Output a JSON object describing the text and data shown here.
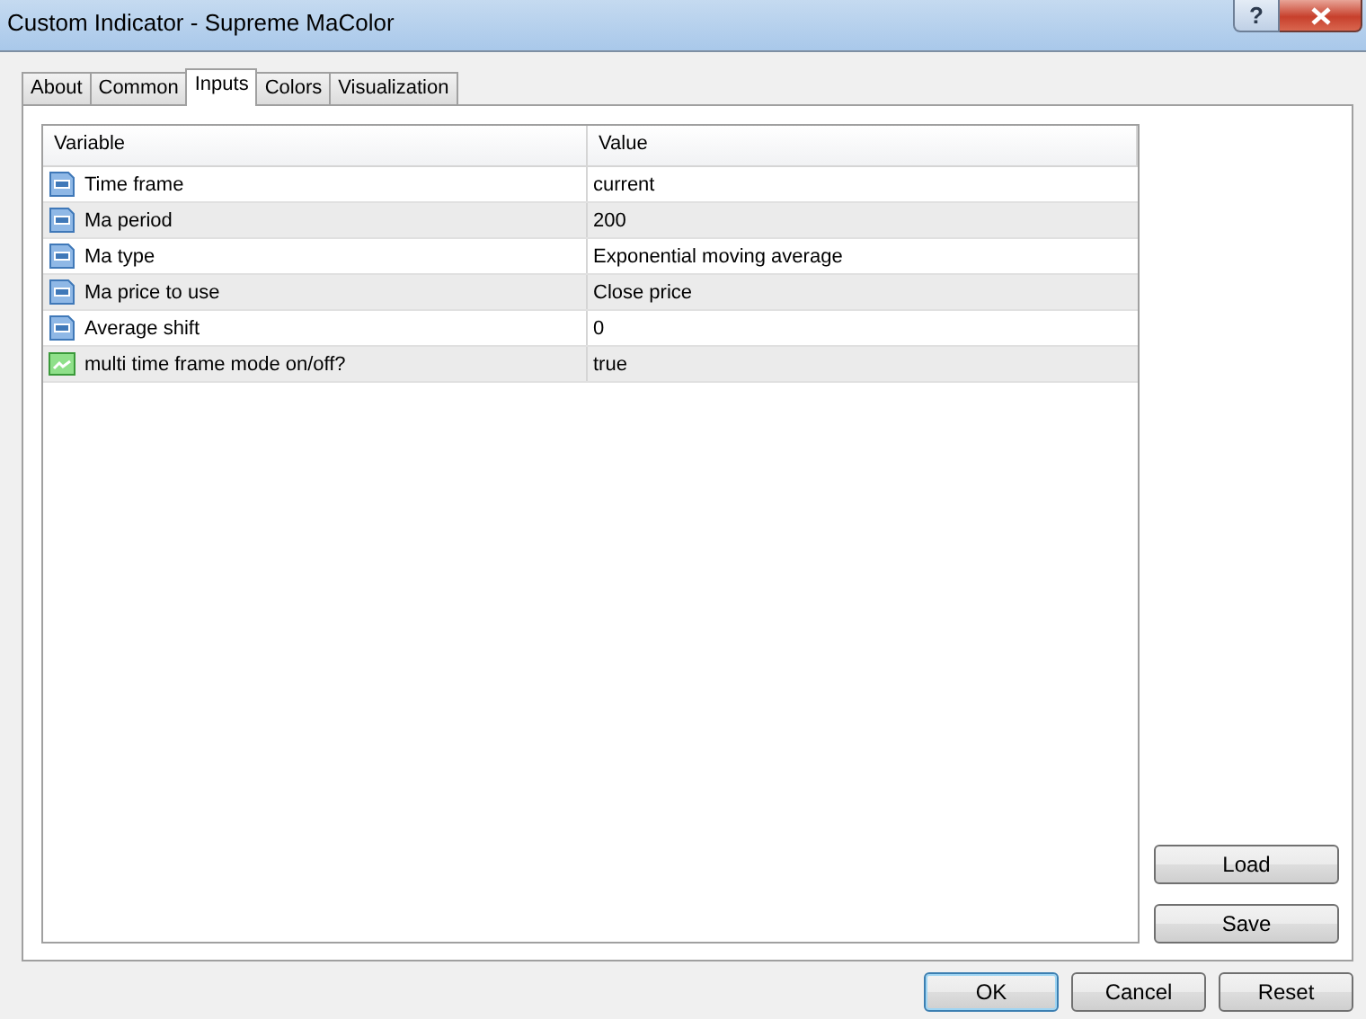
{
  "window": {
    "title": "Custom Indicator - Supreme MaColor",
    "help": "?"
  },
  "tabs": [
    {
      "label": "About",
      "selected": false
    },
    {
      "label": "Common",
      "selected": false
    },
    {
      "label": "Inputs",
      "selected": true
    },
    {
      "label": "Colors",
      "selected": false
    },
    {
      "label": "Visualization",
      "selected": false
    }
  ],
  "table": {
    "columns": [
      "Variable",
      "Value"
    ],
    "rows": [
      {
        "kind": "number",
        "variable": "Time frame",
        "value": "current"
      },
      {
        "kind": "number",
        "variable": "Ma period",
        "value": "200"
      },
      {
        "kind": "number",
        "variable": "Ma type",
        "value": "Exponential moving average"
      },
      {
        "kind": "number",
        "variable": "Ma price to use",
        "value": "Close price"
      },
      {
        "kind": "number",
        "variable": "Average shift",
        "value": "0"
      },
      {
        "kind": "bool",
        "variable": "multi time frame mode on/off?",
        "value": "true"
      }
    ]
  },
  "side_buttons": [
    "Load",
    "Save"
  ],
  "buttons": [
    {
      "label": "OK",
      "default": true
    },
    {
      "label": "Cancel",
      "default": false
    },
    {
      "label": "Reset",
      "default": false
    }
  ]
}
